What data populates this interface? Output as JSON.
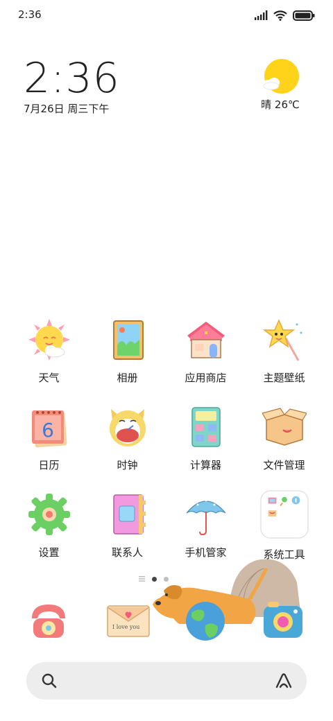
{
  "status_bar": {
    "time": "2:36",
    "icons": [
      "signal-icon",
      "wifi-icon",
      "battery-icon"
    ]
  },
  "clock_widget": {
    "time": "2:36",
    "date": "7月26日 周三下午"
  },
  "weather_widget": {
    "text": "晴 26℃",
    "icon": "sun-cloud-icon"
  },
  "apps": [
    {
      "label": "天气",
      "icon": "sun-icon"
    },
    {
      "label": "相册",
      "icon": "photo-frame-icon"
    },
    {
      "label": "应用商店",
      "icon": "house-icon"
    },
    {
      "label": "主题壁纸",
      "icon": "star-wand-icon"
    },
    {
      "label": "日历",
      "icon": "calendar-icon"
    },
    {
      "label": "时钟",
      "icon": "cat-clock-icon"
    },
    {
      "label": "计算器",
      "icon": "calculator-icon"
    },
    {
      "label": "文件管理",
      "icon": "box-icon"
    },
    {
      "label": "设置",
      "icon": "gear-icon"
    },
    {
      "label": "联系人",
      "icon": "notebook-icon"
    },
    {
      "label": "手机管家",
      "icon": "umbrella-icon"
    },
    {
      "label": "系统工具",
      "icon": "folder-icon"
    }
  ],
  "dock": {
    "phone_icon": "telephone-icon",
    "messages_icon": "envelope-icon",
    "messages_text": "I love you",
    "browser_icon": "globe-icon",
    "camera_icon": "camera-icon",
    "decoration": "dog-illustration"
  },
  "search_bar": {
    "search_icon": "search-icon",
    "assistant_icon": "assistant-icon"
  },
  "colors": {
    "background": "#ffffff",
    "text": "#222222",
    "search_bg": "#ededed",
    "sun": "#ffd31a"
  }
}
